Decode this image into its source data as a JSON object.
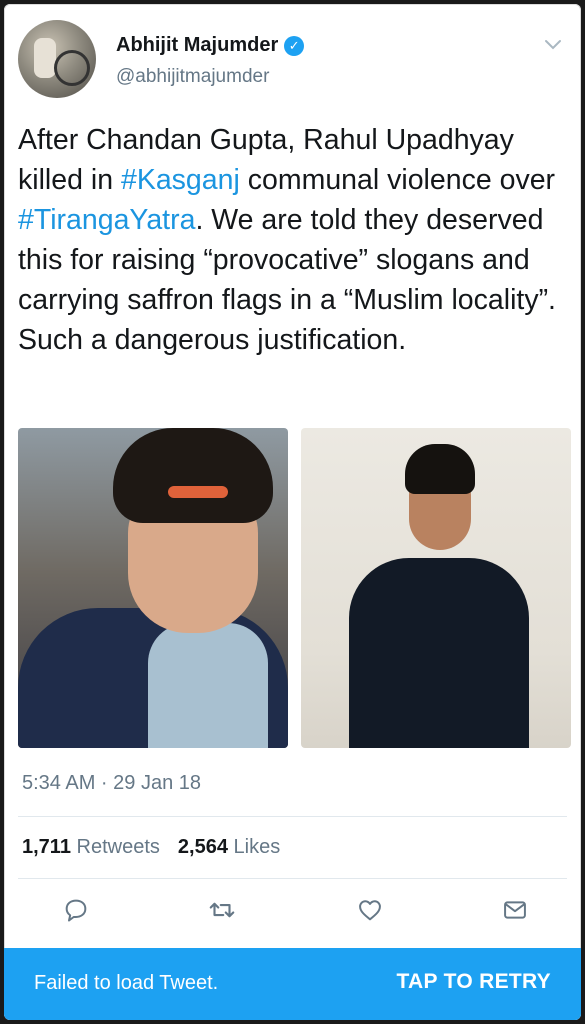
{
  "author": {
    "name": "Abhijit Majumder",
    "handle": "@abhijitmajumder",
    "verified_icon": "verified-badge-icon",
    "menu_icon": "chevron-down-icon"
  },
  "tweet": {
    "parts": [
      {
        "text": "After Chandan Gupta, Rahul Upadhyay killed in ",
        "hashtag": false
      },
      {
        "text": "#Kasganj",
        "hashtag": true
      },
      {
        "text": " communal violence over ",
        "hashtag": false
      },
      {
        "text": "#TirangaYatra",
        "hashtag": true
      },
      {
        "text": ". We are told they deserved this for raising “provocative” slogans and carrying saffron flags in a “Muslim locality”. Such a dangerous justification.",
        "hashtag": false
      }
    ],
    "hashtag_color": "#1b95e0"
  },
  "timestamp": "5:34 AM · 29 Jan 18",
  "stats": {
    "retweets_count": "1,711",
    "retweets_label": "Retweets",
    "likes_count": "2,564",
    "likes_label": "Likes"
  },
  "actions": [
    {
      "name": "reply-icon"
    },
    {
      "name": "retweet-icon"
    },
    {
      "name": "like-icon"
    },
    {
      "name": "message-icon"
    }
  ],
  "retry": {
    "message": "Failed to load Tweet.",
    "button": "TAP TO RETRY"
  },
  "colors": {
    "accent": "#1da1f2",
    "text": "#14171a",
    "secondary": "#657786"
  }
}
